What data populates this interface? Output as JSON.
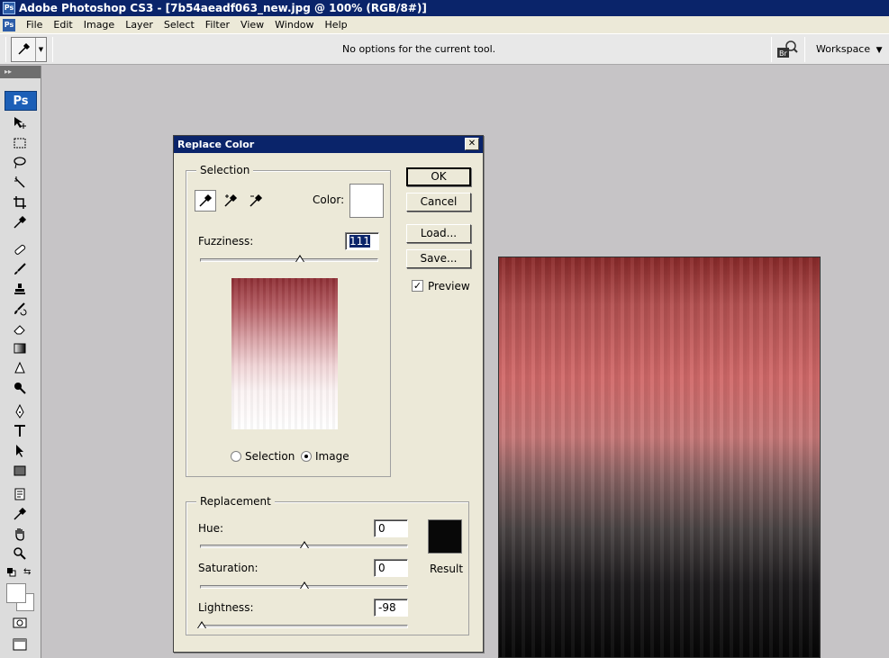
{
  "window": {
    "title": "Adobe Photoshop CS3 - [7b54aeadf063_new.jpg @ 100% (RGB/8#)]",
    "app_icon": "Ps"
  },
  "menubar": {
    "items": [
      "File",
      "Edit",
      "Image",
      "Layer",
      "Select",
      "Filter",
      "View",
      "Window",
      "Help"
    ]
  },
  "optionsbar": {
    "message": "No options for the current tool.",
    "workspace_label": "Workspace",
    "bridge_icon": "Br"
  },
  "toolbox": {
    "logo": "Ps"
  },
  "dialog": {
    "title": "Replace Color",
    "close_label": "✕",
    "selection": {
      "label": "Selection",
      "color_label": "Color:",
      "color_value": "#ffffff",
      "fuzziness_label": "Fuzziness:",
      "fuzziness_value": "111",
      "fuzziness_level": 0.56,
      "radio_selection": "Selection",
      "radio_image": "Image",
      "selected_mode": "Image"
    },
    "buttons": {
      "ok": "OK",
      "cancel": "Cancel",
      "load": "Load...",
      "save": "Save..."
    },
    "preview": {
      "label": "Preview",
      "checked": true
    },
    "replacement": {
      "label": "Replacement",
      "hue_label": "Hue:",
      "hue_value": "0",
      "hue_level": 0.5,
      "saturation_label": "Saturation:",
      "saturation_value": "0",
      "saturation_level": 0.5,
      "lightness_label": "Lightness:",
      "lightness_value": "-98",
      "lightness_level": 0.01,
      "result_label": "Result",
      "result_color": "#080808"
    }
  },
  "colors": {
    "titlebar": "#0a246a",
    "dialog_bg": "#ece9d8",
    "workspace_bg": "#c6c4c6"
  }
}
